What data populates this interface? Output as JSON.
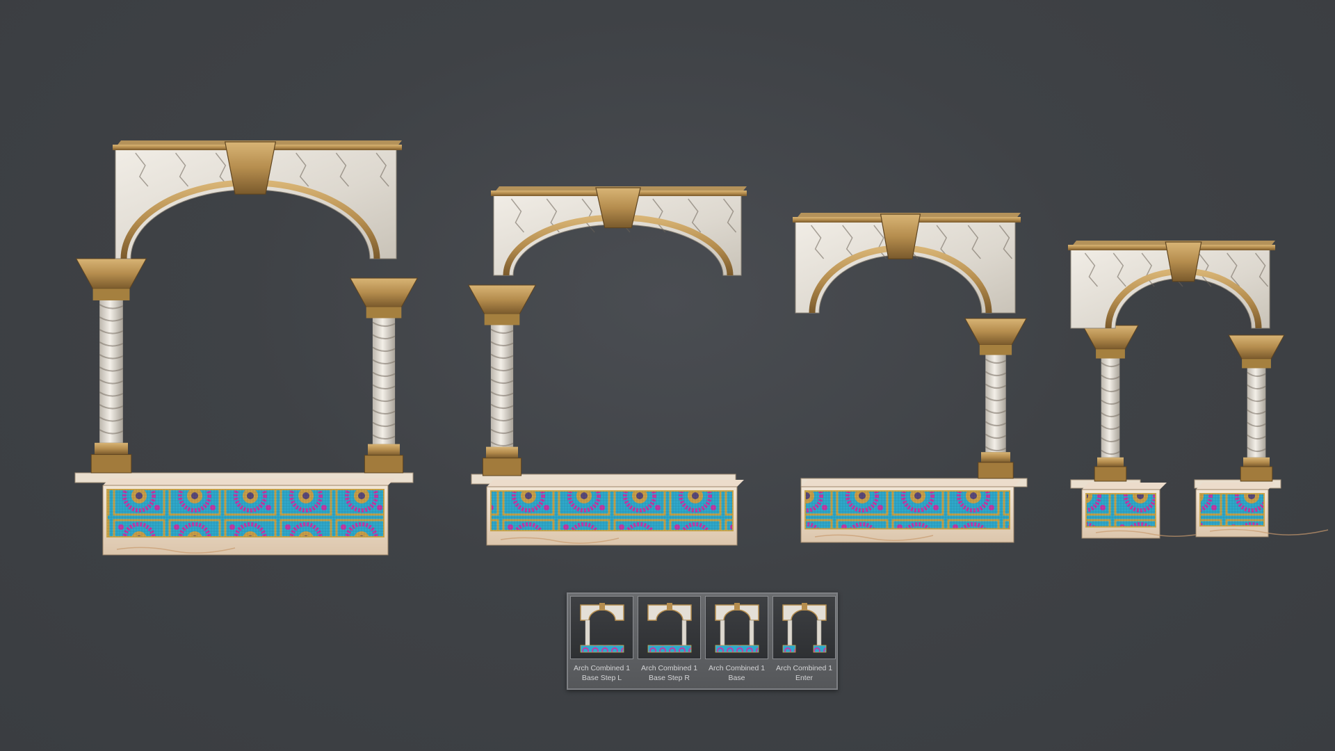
{
  "presets": [
    {
      "line1": "Arch Combined 1",
      "line2": "Base Step L",
      "variant": "step-l"
    },
    {
      "line1": "Arch Combined 1",
      "line2": "Base Step R",
      "variant": "step-r"
    },
    {
      "line1": "Arch Combined 1",
      "line2": "Base",
      "variant": "base"
    },
    {
      "line1": "Arch Combined 1",
      "line2": "Enter",
      "variant": "enter"
    }
  ],
  "colors": {
    "marble": "#e6e2da",
    "marble_vein": "#6b6358",
    "gold": "#b58d4e",
    "gold_dark": "#7a5a2c",
    "mosaic_cyan": "#37b8d8",
    "mosaic_magenta": "#c23aa8",
    "mosaic_gold": "#c9a54a",
    "warm_marble": "#ead9c4"
  }
}
